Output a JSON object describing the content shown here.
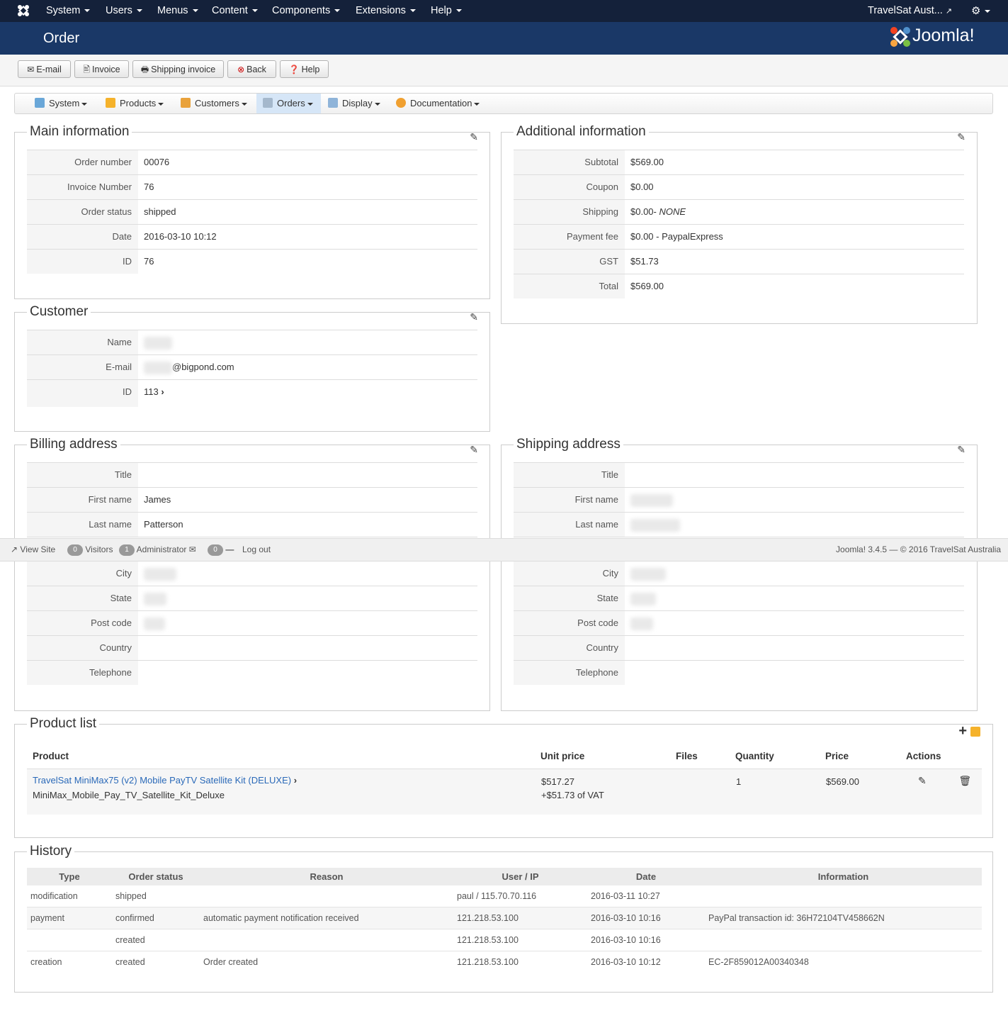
{
  "topbar": {
    "menus": [
      "System",
      "Users",
      "Menus",
      "Content",
      "Components",
      "Extensions",
      "Help"
    ],
    "site_name": "TravelSat Aust..."
  },
  "header": {
    "title": "Order",
    "brand": "Joomla!"
  },
  "toolbar": {
    "email": "E-mail",
    "invoice": "Invoice",
    "shipping_invoice": "Shipping invoice",
    "back": "Back",
    "help": "Help"
  },
  "submenu": {
    "items": [
      "System",
      "Products",
      "Customers",
      "Orders",
      "Display",
      "Documentation"
    ]
  },
  "main_info": {
    "legend": "Main information",
    "rows": [
      {
        "label": "Order number",
        "value": "00076"
      },
      {
        "label": "Invoice Number",
        "value": "76"
      },
      {
        "label": "Order status",
        "value": "shipped"
      },
      {
        "label": "Date",
        "value": "2016-03-10 10:12"
      },
      {
        "label": "ID",
        "value": "76"
      }
    ]
  },
  "additional_info": {
    "legend": "Additional information",
    "rows": [
      {
        "label": "Subtotal",
        "value": "$569.00"
      },
      {
        "label": "Coupon",
        "value": "$0.00"
      },
      {
        "label": "Shipping",
        "value": "$0.00- ",
        "extra": "NONE"
      },
      {
        "label": "Payment fee",
        "value": "$0.00 - PaypalExpress"
      },
      {
        "label": "GST",
        "value": "$51.73"
      },
      {
        "label": "Total",
        "value": "$569.00"
      }
    ]
  },
  "customer": {
    "legend": "Customer",
    "rows": [
      {
        "label": "Name",
        "value": ""
      },
      {
        "label": "E-mail",
        "value": "@bigpond.com"
      },
      {
        "label": "ID",
        "value": "113"
      }
    ]
  },
  "billing": {
    "legend": "Billing address",
    "rows_top": [
      {
        "label": "Title",
        "value": ""
      },
      {
        "label": "First name",
        "value": "James"
      },
      {
        "label": "Last name",
        "value": "Patterson"
      }
    ],
    "rows_bottom": [
      {
        "label": "City",
        "value": ""
      },
      {
        "label": "State",
        "value": ""
      },
      {
        "label": "Post code",
        "value": ""
      },
      {
        "label": "Country",
        "value": ""
      },
      {
        "label": "Telephone",
        "value": ""
      }
    ]
  },
  "shipping": {
    "legend": "Shipping address",
    "rows_top": [
      {
        "label": "Title",
        "value": ""
      },
      {
        "label": "First name",
        "value": ""
      },
      {
        "label": "Last name",
        "value": ""
      }
    ],
    "rows_bottom": [
      {
        "label": "City",
        "value": ""
      },
      {
        "label": "State",
        "value": ""
      },
      {
        "label": "Post code",
        "value": ""
      },
      {
        "label": "Country",
        "value": ""
      },
      {
        "label": "Telephone",
        "value": ""
      }
    ]
  },
  "statusbar": {
    "view_site": "View Site",
    "visitors_count": "0",
    "visitors": "Visitors",
    "admin_count": "1",
    "administrator": "Administrator",
    "messages_count": "0",
    "logout": "Log out",
    "footer": "Joomla! 3.4.5 — © 2016 TravelSat Australia"
  },
  "product_list": {
    "legend": "Product list",
    "headers": [
      "Product",
      "Unit price",
      "Files",
      "Quantity",
      "Price",
      "Actions"
    ],
    "items": [
      {
        "name": "TravelSat MiniMax75 (v2) Mobile PayTV Satellite Kit (DELUXE)",
        "code": "MiniMax_Mobile_Pay_TV_Satellite_Kit_Deluxe",
        "unit_price": "$517.27",
        "vat": "+$51.73 of VAT",
        "quantity": "1",
        "price": "$569.00"
      }
    ]
  },
  "history": {
    "legend": "History",
    "headers": [
      "Type",
      "Order status",
      "Reason",
      "User / IP",
      "Date",
      "Information"
    ],
    "rows": [
      [
        "modification",
        "shipped",
        "",
        "paul / 115.70.70.116",
        "2016-03-11 10:27",
        ""
      ],
      [
        "payment",
        "confirmed",
        "automatic payment notification received",
        "121.218.53.100",
        "2016-03-10 10:16",
        "PayPal transaction id: 36H72104TV458662N"
      ],
      [
        "",
        "created",
        "",
        "121.218.53.100",
        "2016-03-10 10:16",
        ""
      ],
      [
        "creation",
        "created",
        "Order created",
        "121.218.53.100",
        "2016-03-10 10:12",
        "EC-2F859012A00340348"
      ]
    ]
  }
}
